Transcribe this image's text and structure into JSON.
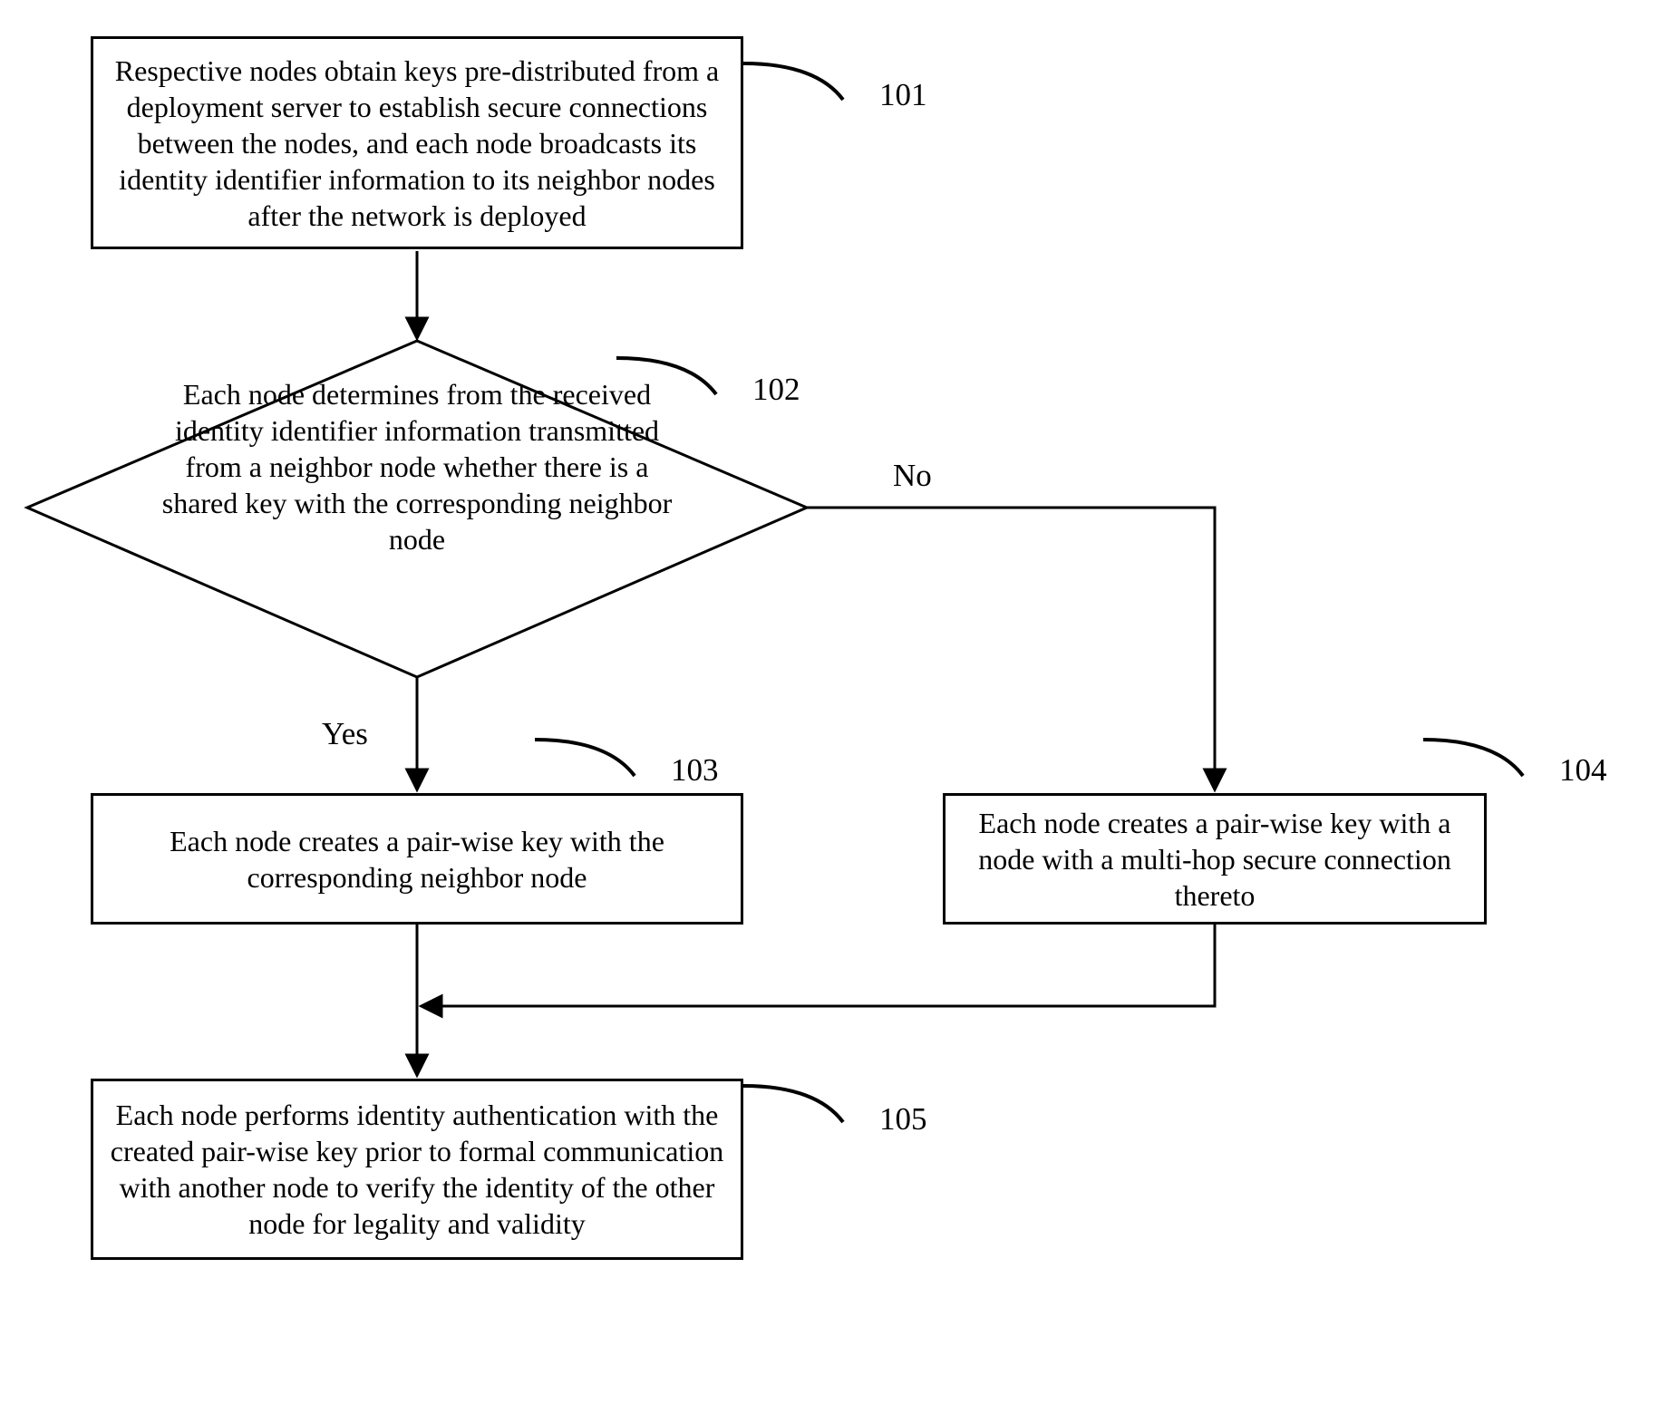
{
  "steps": {
    "s101": {
      "ref": "101",
      "text": "Respective nodes obtain keys pre-distributed from a deployment server to establish secure connections between the nodes, and each node broadcasts its identity identifier information to its neighbor nodes after the network is deployed"
    },
    "s102": {
      "ref": "102",
      "text": "Each node determines from the received identity identifier information transmitted from a neighbor node whether there is a shared key with the corresponding neighbor node"
    },
    "s103": {
      "ref": "103",
      "text": "Each node creates a pair-wise key with the corresponding neighbor node"
    },
    "s104": {
      "ref": "104",
      "text": "Each node creates a pair-wise key with a node with a multi-hop secure connection thereto"
    },
    "s105": {
      "ref": "105",
      "text": "Each node performs identity authentication with the created pair-wise key prior to formal communication with another node to verify the identity of the other node for legality and validity"
    }
  },
  "branches": {
    "yes": "Yes",
    "no": "No"
  }
}
